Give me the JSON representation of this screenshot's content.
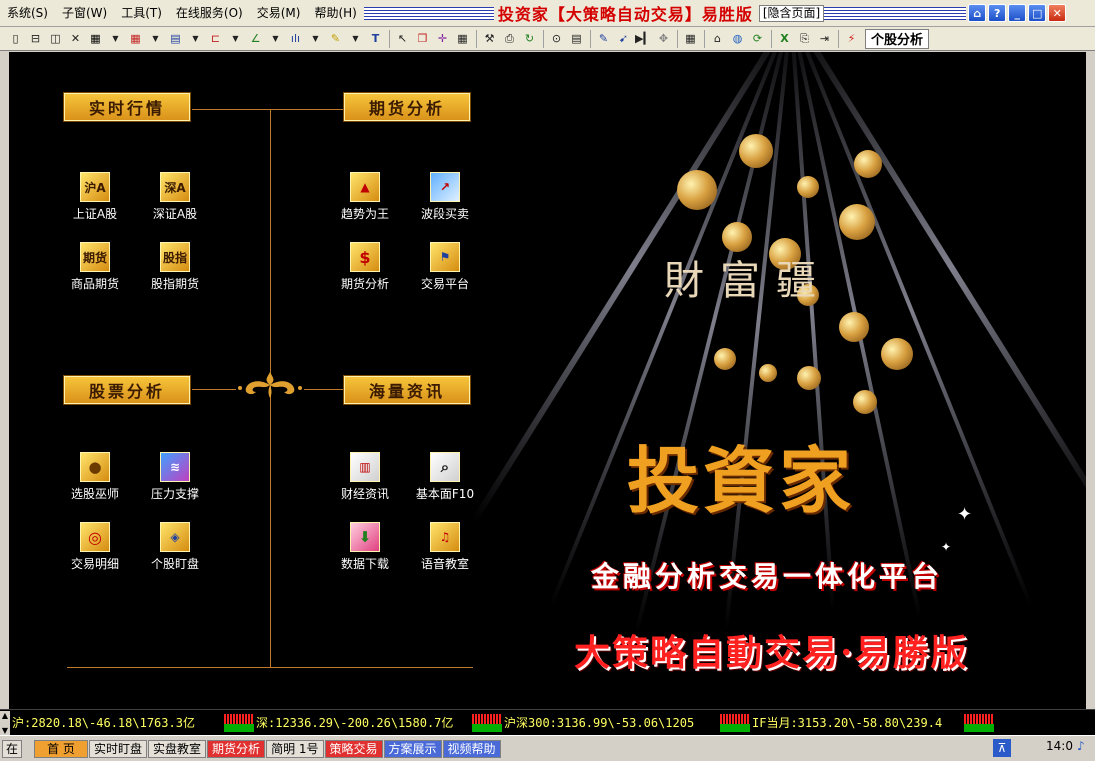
{
  "menu": {
    "items": [
      "系统(S)",
      "子窗(W)",
      "工具(T)",
      "在线服务(O)",
      "交易(M)",
      "帮助(H)"
    ],
    "title": "投资家【大策略自动交易】易胜版",
    "hide_page": "[隐含页面]"
  },
  "window_controls": [
    "home-icon",
    "help-icon",
    "minimize-icon",
    "maximize-icon",
    "close-icon"
  ],
  "toolbar": {
    "stock_analysis_label": "个股分析"
  },
  "sections": {
    "realtime": {
      "title": "实时行情",
      "apps": [
        {
          "icon_text": "沪A",
          "label": "上证A股"
        },
        {
          "icon_text": "深A",
          "label": "深证A股"
        },
        {
          "icon_text": "期货",
          "label": "商品期货"
        },
        {
          "icon_text": "股指",
          "label": "股指期货"
        }
      ]
    },
    "futures": {
      "title": "期货分析",
      "apps": [
        {
          "icon_text": "",
          "label": "趋势为王"
        },
        {
          "icon_text": "",
          "label": "波段买卖"
        },
        {
          "icon_text": "",
          "label": "期货分析"
        },
        {
          "icon_text": "",
          "label": "交易平台"
        }
      ]
    },
    "stocks": {
      "title": "股票分析",
      "apps": [
        {
          "icon_text": "",
          "label": "选股巫师"
        },
        {
          "icon_text": "",
          "label": "压力支撑"
        },
        {
          "icon_text": "",
          "label": "交易明细"
        },
        {
          "icon_text": "",
          "label": "个股盯盘"
        }
      ]
    },
    "news": {
      "title": "海量资讯",
      "apps": [
        {
          "icon_text": "",
          "label": "财经资讯"
        },
        {
          "icon_text": "",
          "label": "基本面F10"
        },
        {
          "icon_text": "",
          "label": "数据下载"
        },
        {
          "icon_text": "",
          "label": "语音教室"
        }
      ]
    }
  },
  "promo": {
    "subtitle": "財富疆",
    "brand": "投資家",
    "tagline": "金融分析交易一体化平台",
    "edition": "大策略自動交易·易勝版"
  },
  "ticker": [
    "沪:2820.18\\-46.18\\1763.3亿",
    "深:12336.29\\-200.26\\1580.7亿",
    "沪深300:3136.99\\-53.06\\1205",
    "IF当月:3153.20\\-58.80\\239.4"
  ],
  "taskbar": {
    "start": "在",
    "tabs": [
      {
        "label": "首 页",
        "style": "orange"
      },
      {
        "label": "实时盯盘",
        "style": "gray"
      },
      {
        "label": "实盘教室",
        "style": "gray"
      },
      {
        "label": "期货分析",
        "style": "red"
      },
      {
        "label": "简明 1号",
        "style": "gray"
      },
      {
        "label": "策略交易",
        "style": "red"
      },
      {
        "label": "方案展示",
        "style": "blue"
      },
      {
        "label": "视频帮助",
        "style": "blue"
      }
    ],
    "clock": "14:0"
  }
}
